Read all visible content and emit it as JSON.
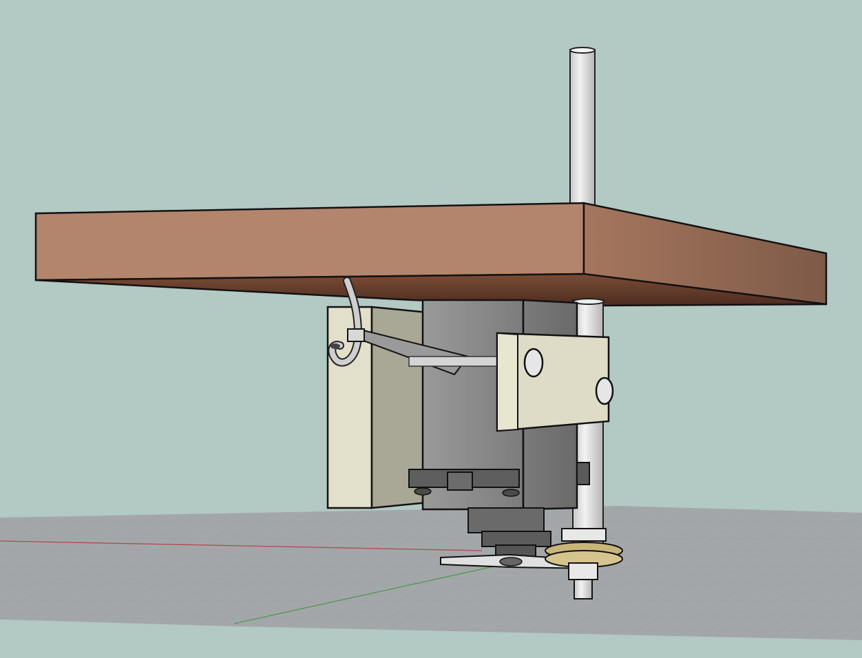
{
  "viewport": {
    "background_color": "#b3c9c3",
    "grid_color": "#a6a8aa",
    "grid_line_color": "#8c8f92",
    "x_axis_color": "#b04a4a",
    "y_axis_color": "#4a9a4a"
  },
  "materials": {
    "wood_top": "#b88a72",
    "wood_front": "#b08068",
    "wood_side": "#8a6450",
    "wood_bottom": "#5a3526",
    "plastic_light": "#e0ddc8",
    "plastic_mid": "#a8a696",
    "servo_gray": "#8a8a8a",
    "servo_dark": "#5e5e5e",
    "metal_rod": "#dcdcdc",
    "cable": "#c8c8c8",
    "brass_washer": "#c9b47a"
  },
  "icons": [
    "platform-icon",
    "servo-icon",
    "rod-icon",
    "bracket-icon",
    "hook-icon"
  ]
}
